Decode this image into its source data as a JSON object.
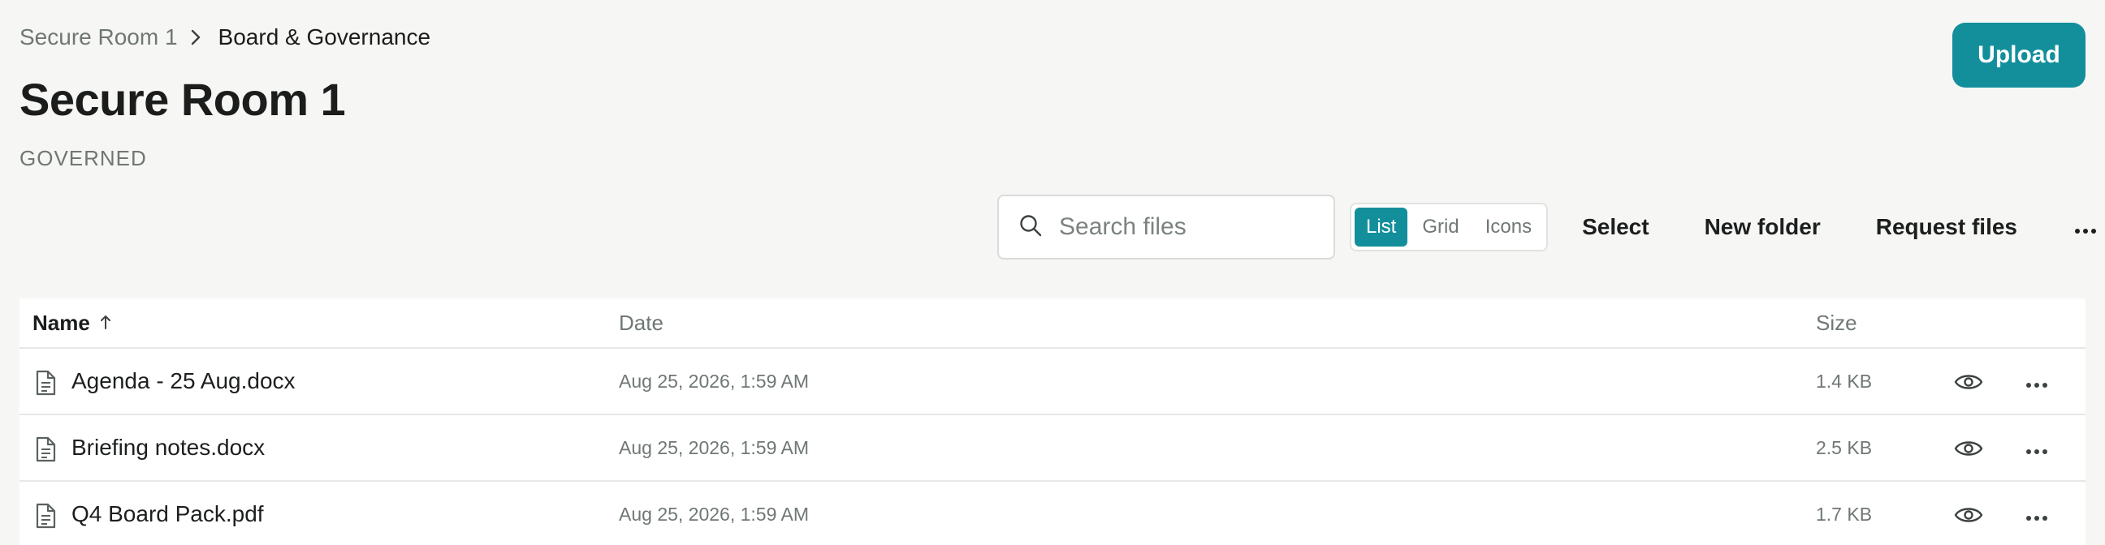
{
  "breadcrumb": {
    "parent": "Secure Room 1",
    "current": "Board & Governance"
  },
  "page": {
    "title": "Secure Room 1",
    "subtitle": "GOVERNED"
  },
  "header": {
    "upload_label": "Upload"
  },
  "toolbar": {
    "search_placeholder": "Search files",
    "view_options": [
      "List",
      "Grid",
      "Icons"
    ],
    "active_view": "List",
    "select_label": "Select",
    "new_folder_label": "New folder",
    "request_files_label": "Request files"
  },
  "table": {
    "columns": {
      "name": "Name",
      "date": "Date",
      "size": "Size"
    },
    "sort": "ascending",
    "rows": [
      {
        "name": "Agenda - 25 Aug.docx",
        "date": "Aug 25, 2026, 1:59 AM",
        "size": "1.4 KB"
      },
      {
        "name": "Briefing notes.docx",
        "date": "Aug 25, 2026, 1:59 AM",
        "size": "2.5 KB"
      },
      {
        "name": "Q4 Board Pack.pdf",
        "date": "Aug 25, 2026, 1:59 AM",
        "size": "1.7 KB"
      }
    ]
  },
  "colors": {
    "accent": "#138f9c",
    "background": "#f6f6f4"
  }
}
